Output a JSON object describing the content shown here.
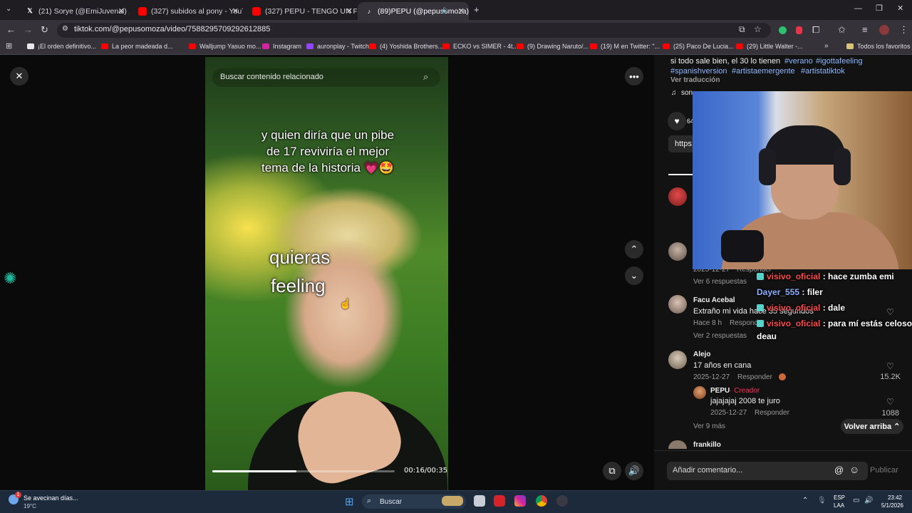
{
  "browser": {
    "tabs": [
      {
        "title": "(21) Sorye (@EmiJuvenal) / X",
        "icon": "x-logo-icon"
      },
      {
        "title": "(327) subidos al pony - YouTub",
        "icon": "youtube-icon"
      },
      {
        "title": "(327) PEPU - TENGO UN FEELIN",
        "icon": "youtube-icon"
      },
      {
        "title": "(89)PEPU (@pepusomoza) |",
        "icon": "tiktok-icon"
      }
    ],
    "url": "tiktok.com/@pepusomoza/video/7588295709292612885",
    "bookmarks": [
      "¡El orden definitivo...",
      "La peor madeada d...",
      "Walljump Yasuo mo...",
      "Instagram",
      "auronplay - Twitch",
      "(4) Yoshida Brothers...",
      "ECKO vs SIMER - 4t...",
      "(9) Drawing Naruto/...",
      "(19) M en Twitter: \"...",
      "(25) Paco De Lucia...",
      "(29) Little Walter -..."
    ],
    "all_favorites": "Todos los favoritos"
  },
  "video": {
    "search_placeholder": "Buscar contenido relacionado",
    "caption_lines": [
      "y quien diría que un pibe",
      "de 17 reviviría el mejor",
      "tema de la historia 💗🤩"
    ],
    "lyric_1": "quieras",
    "lyric_2": "feeling",
    "time": "00:16/00:35",
    "progress_fraction": 0.46
  },
  "panel": {
    "desc_line1": "si todo sale bien, el 30 lo tienen",
    "desc_tag1": "#verano",
    "desc_tag2": "#igottafeeling",
    "desc_tag3": "#spanishversion",
    "desc_tag4": "#artistaemergente",
    "desc_tag5": "#artistatiktok",
    "translate": "Ver traducción",
    "sound": "son",
    "likes_short": "64",
    "link_short": "https:",
    "comments": {
      "replies_6": "Ver 6 respuestas",
      "c1_date": "2025-12-27",
      "c1_reply": "Responder",
      "facu_name": "Facu Acebal",
      "facu_text": "Extraño mi vida hace 35 segundos",
      "facu_meta": "Hace 8 h",
      "facu_reply": "Responder",
      "replies_2": "Ver 2 respuestas",
      "alejo_name": "Alejo",
      "alejo_text": "17 años en cana",
      "alejo_date": "2025-12-27",
      "alejo_reply": "Responder",
      "alejo_likes": "15.2K",
      "pepu_name": "PEPU",
      "pepu_badge": "Creador",
      "pepu_text": "jajajajaj 2008 te juro",
      "pepu_date": "2025-12-27",
      "pepu_reply": "Responder",
      "pepu_likes": "1088",
      "more_9": "Ver 9 más",
      "frankillo_name": "frankillo"
    },
    "back_to_top": "Volver arriba",
    "comment_placeholder": "Añadir comentario...",
    "publish": "Publicar"
  },
  "stream_chat": [
    {
      "user": "visivo_oficial",
      "msg": ": hace zumba emi",
      "color": "#ff4b4b",
      "badge": true
    },
    {
      "user": "Dayer_555",
      "msg": ": filer",
      "color": "#8fb1ff",
      "badge": false
    },
    {
      "user": "visivo_oficial",
      "msg": ": dale",
      "color": "#ff4b4b",
      "badge": true
    },
    {
      "user": "visivo_oficial",
      "msg": ": para mí estás celoso",
      "color": "#ff4b4b",
      "badge": true
    },
    {
      "user": "",
      "msg": "deau",
      "color": "#ffffff",
      "badge": false
    }
  ],
  "taskbar": {
    "weather_title": "Se avecinan días...",
    "weather_temp": "19°C",
    "search": "Buscar",
    "lang1": "ESP",
    "lang2": "LAA",
    "time": "23:42",
    "date": "5/1/2026",
    "notif_count": "1"
  },
  "colors": {
    "accent_pink": "#fe2c55",
    "hashtag": "#8fb6ff",
    "chrome_bg": "#35323a"
  }
}
